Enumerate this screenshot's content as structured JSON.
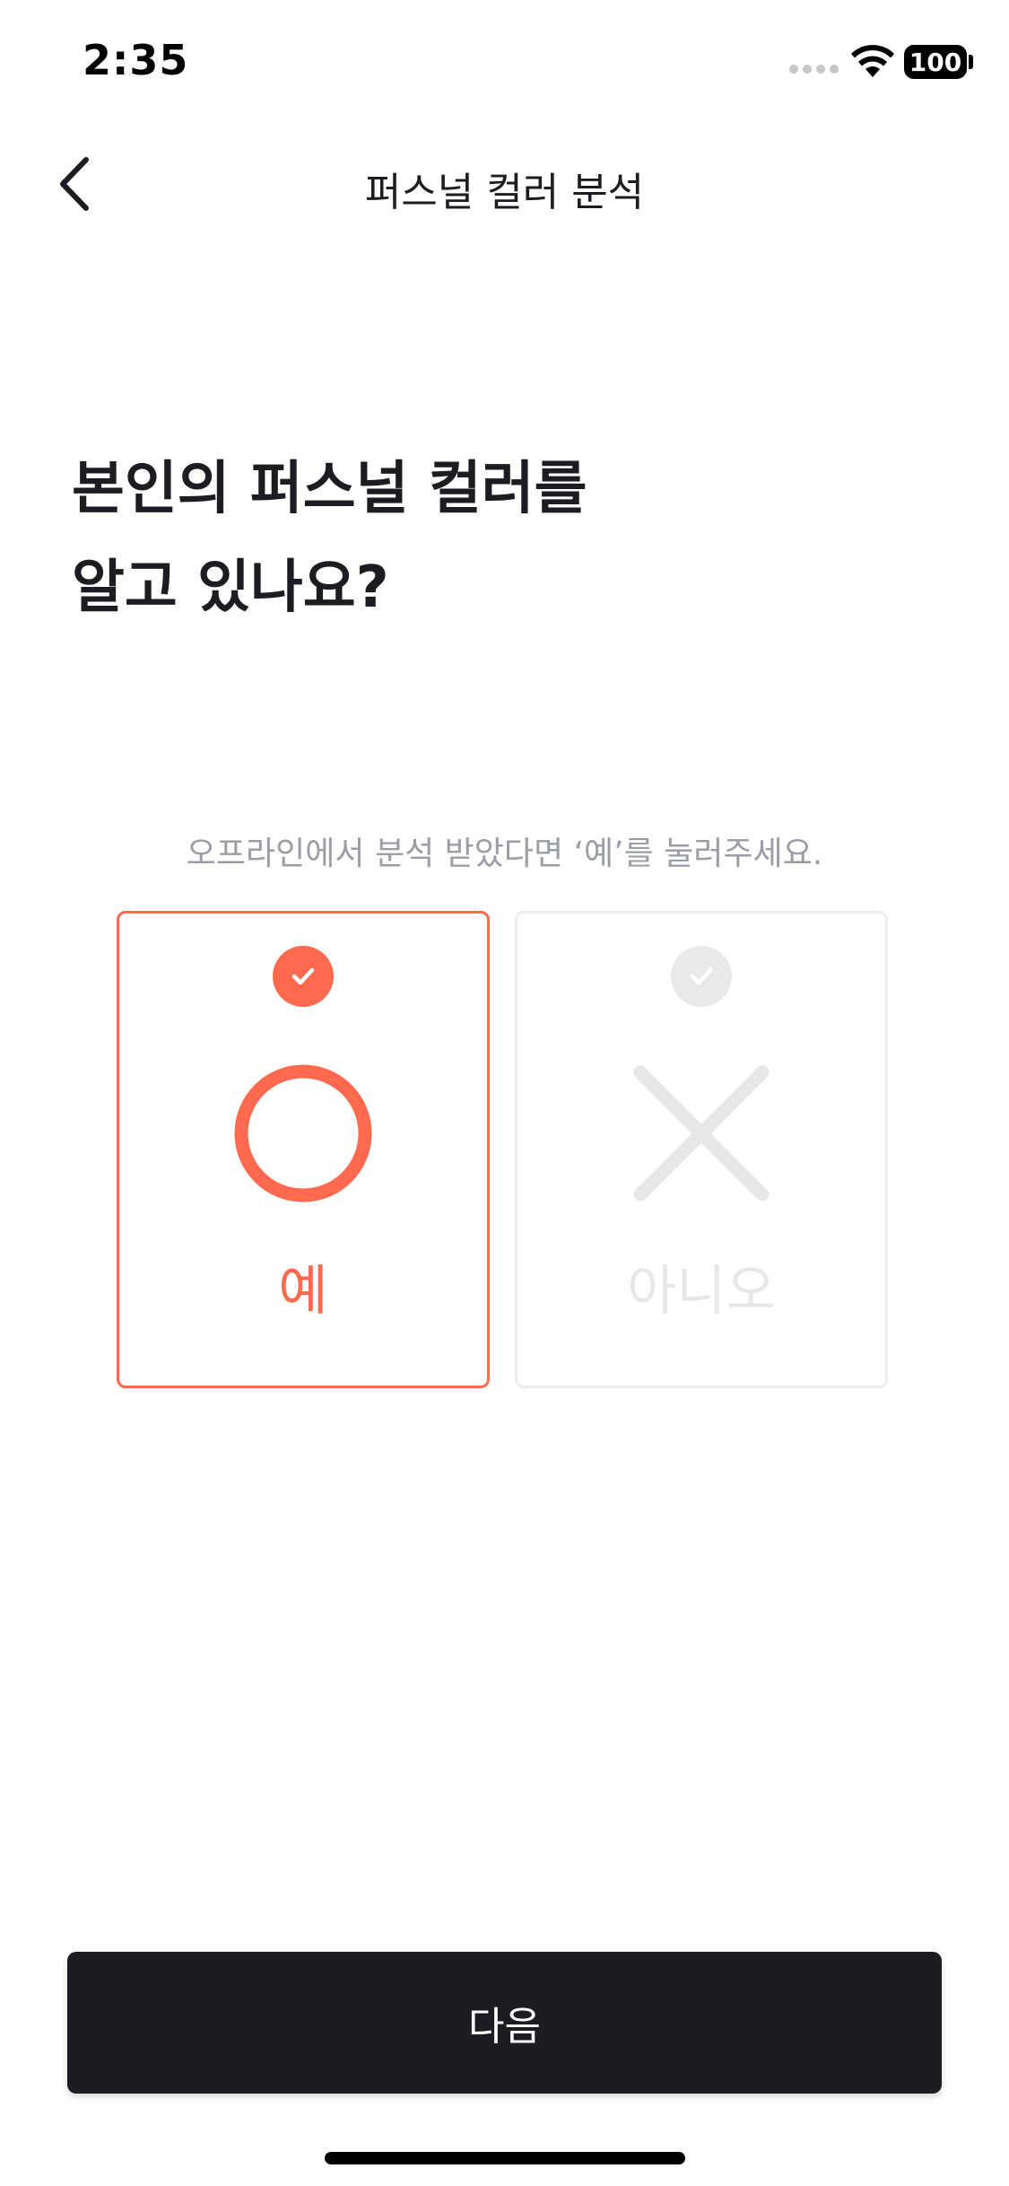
{
  "status_bar": {
    "time": "2:35",
    "battery": "100"
  },
  "nav": {
    "title": "퍼스널 컬러 분석",
    "back_icon": "chevron-left-icon"
  },
  "question": {
    "title": "본인의 퍼스널 컬러를\n알고 있나요?"
  },
  "hint": "오프라인에서 분석 받았다면 ‘예’를 눌러주세요.",
  "choices": [
    {
      "label": "예",
      "symbol": "circle-o-icon",
      "selected": true
    },
    {
      "label": "아니오",
      "symbol": "x-mark-icon",
      "selected": false
    }
  ],
  "next_button": {
    "label": "다음"
  },
  "colors": {
    "accent": "#ff6a4f",
    "dark": "#1b1d22",
    "muted": "#9b9ea7",
    "disabled": "#e7e7ea"
  }
}
